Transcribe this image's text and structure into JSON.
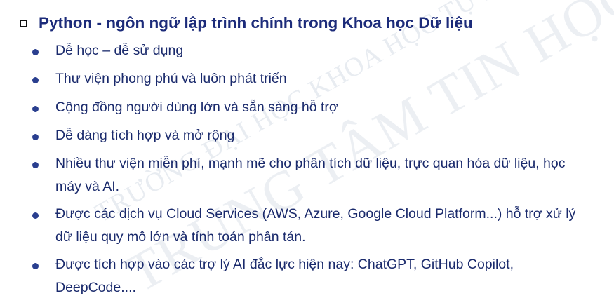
{
  "heading": "Python - ngôn ngữ lập trình chính trong Khoa học Dữ liệu",
  "bullets": [
    "Dễ học – dễ sử dụng",
    "Thư viện phong phú và luôn phát triển",
    "Cộng đồng người dùng lớn và sẵn sàng hỗ trợ",
    "Dễ dàng tích hợp và mở rộng",
    "Nhiều thư viện miễn phí, mạnh mẽ cho phân tích dữ liệu, trực quan hóa dữ liệu, học máy và AI.",
    "Được các dịch vụ Cloud Services (AWS, Azure, Google Cloud Platform...) hỗ trợ xử lý dữ liệu quy mô lớn và tính toán phân tán.",
    "Được tích hợp vào các trợ lý AI đắc lực hiện nay: ChatGPT, GitHub Copilot, DeepCode...."
  ],
  "watermark": {
    "line1": "TRƯỜNG ĐẠI HỌC KHOA HỌC TỰ NHIÊN",
    "line2": "TRUNG TÂM TIN HỌC"
  },
  "colors": {
    "heading": "#1c2b7a",
    "text": "#1a2a6c",
    "bullet": "#2a3f8f",
    "watermark": "#d6dde6"
  }
}
